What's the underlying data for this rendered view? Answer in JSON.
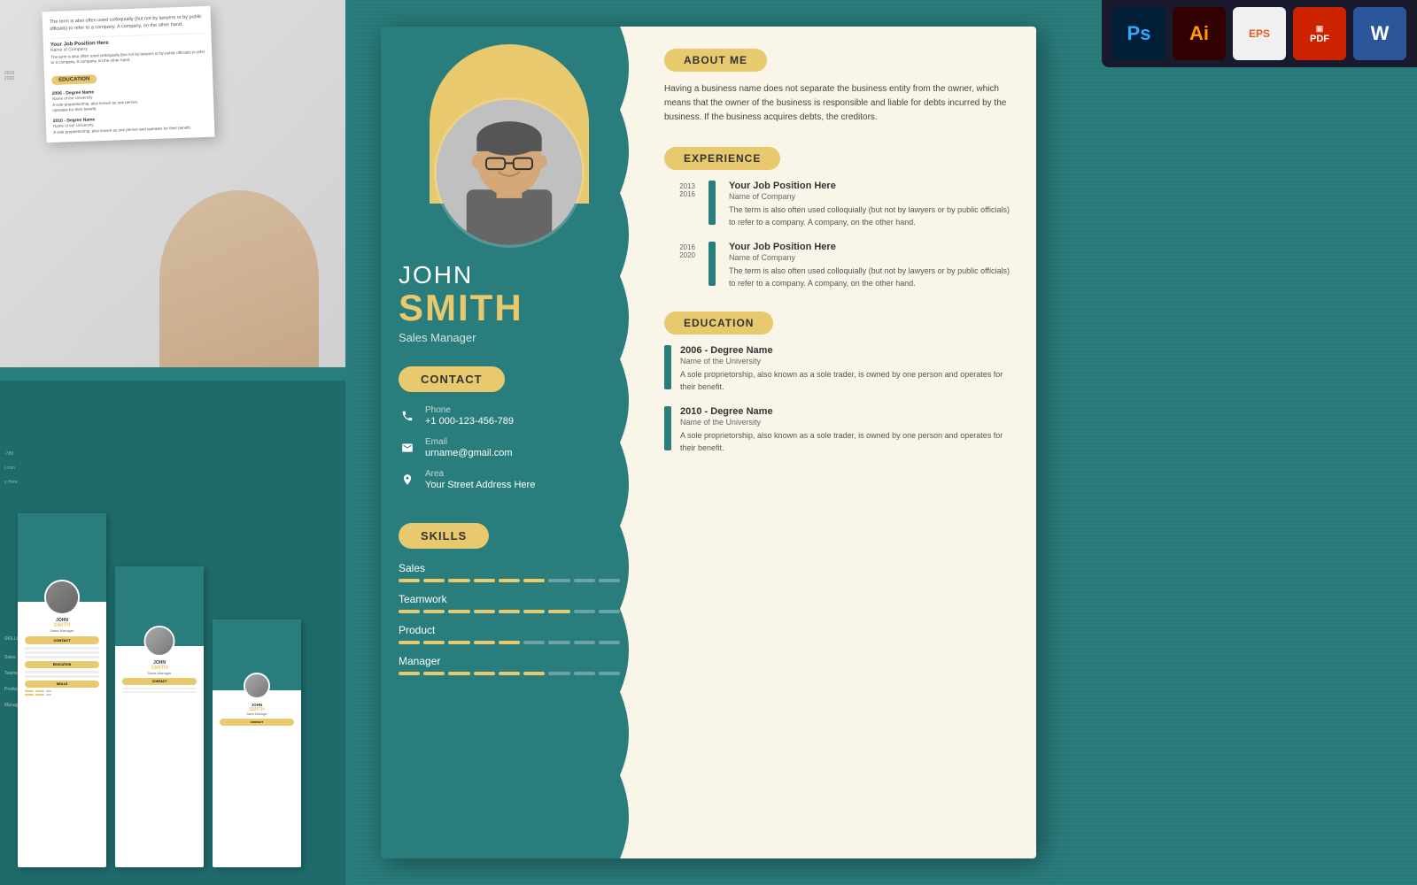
{
  "toolbar": {
    "tools": [
      {
        "label": "Ps",
        "name": "photoshop",
        "class": "tool-ps"
      },
      {
        "label": "Ai",
        "name": "illustrator",
        "class": "tool-ai"
      },
      {
        "label": "EPS",
        "name": "eps",
        "class": "tool-eps"
      },
      {
        "label": "PDF",
        "name": "pdf",
        "class": "tool-pdf"
      },
      {
        "label": "W",
        "name": "word",
        "class": "tool-word"
      }
    ]
  },
  "resume": {
    "name_first": "JOHN",
    "name_last": "SMITH",
    "title": "Sales Manager",
    "contact_label": "CONTACT",
    "contact": {
      "phone_label": "Phone",
      "phone": "+1 000-123-456-789",
      "email_label": "Email",
      "email": "urname@gmail.com",
      "address_label": "Area",
      "address": "Your Street Address Here"
    },
    "skills_label": "SKILLS",
    "skills": [
      {
        "name": "Sales",
        "filled": 6,
        "empty": 3
      },
      {
        "name": "Teamwork",
        "filled": 7,
        "empty": 2
      },
      {
        "name": "Product",
        "filled": 5,
        "empty": 4
      },
      {
        "name": "Manager",
        "filled": 6,
        "empty": 3
      }
    ],
    "about_label": "ABOUT ME",
    "about_text": "Having a business name does not separate the business entity from the owner, which means that the owner of the business is responsible and liable for debts incurred by the business. If the business acquires debts, the creditors.",
    "experience_label": "EXPERIENCE",
    "experience": [
      {
        "years": "2013\n2016",
        "job_title": "Your Job Position Here",
        "company": "Name of Company",
        "description": "The term is also often used colloquially (but not by lawyers or by public officials) to refer to a company. A company, on the other hand."
      },
      {
        "years": "2016\n2020",
        "job_title": "Your Job Position Here",
        "company": "Name of Company",
        "description": "The term is also often used colloquially (but not by lawyers or by public officials) to refer to a company. A company, on the other hand."
      }
    ],
    "education_label": "EDUCATION",
    "education": [
      {
        "year": "2006",
        "degree": "Degree Name",
        "school": "Name of the University",
        "description": "A sole proprietorship, also known as a sole trader, is owned by one person and operates for their benefit."
      },
      {
        "year": "2010",
        "degree": "Degree Name",
        "school": "Name of the University",
        "description": "A sole proprietorship, also known as a sole trader, is owned by one person and operates for their benefit."
      }
    ]
  },
  "left_preview": {
    "education_label": "EDUCATION",
    "skills_label": "SKILLS",
    "job_position": "Your Job Position Here",
    "company_name": "Name of Company",
    "description": "The term is also often used colloquially (but not by lawyers or by public officials) to refer to a company. A company, on the other hand.",
    "degree_2006": "2006 - Degree Name",
    "degree_2010": "2010 - Degree Name"
  }
}
